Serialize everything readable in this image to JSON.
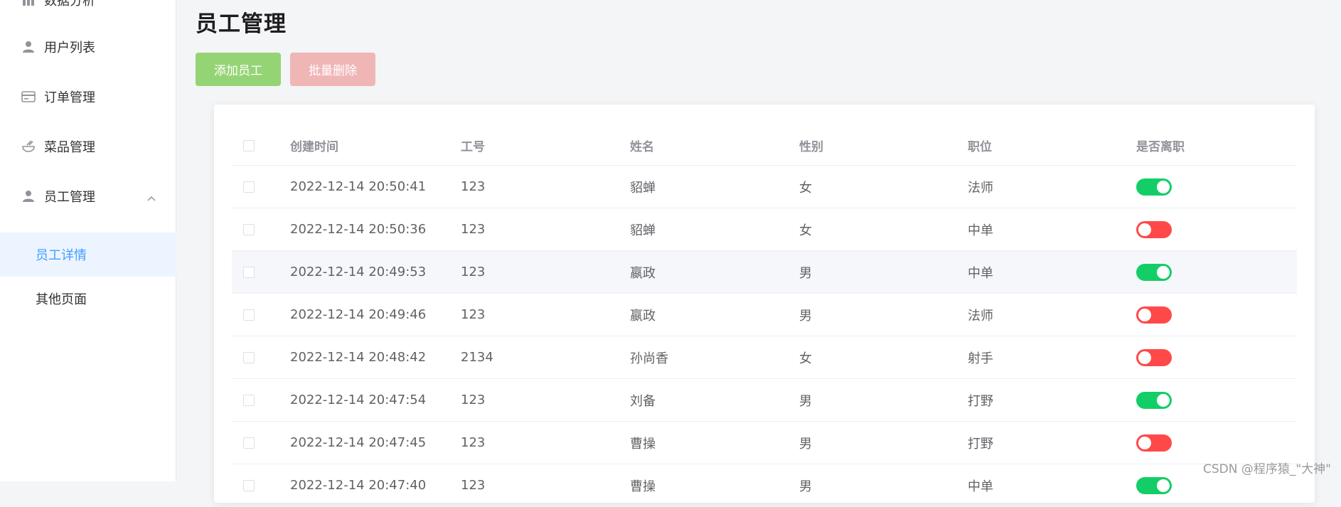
{
  "sidebar": {
    "items": [
      {
        "label": "数据分析",
        "icon": "chart-icon"
      },
      {
        "label": "用户列表",
        "icon": "user-icon"
      },
      {
        "label": "订单管理",
        "icon": "card-icon"
      },
      {
        "label": "菜品管理",
        "icon": "dish-icon"
      },
      {
        "label": "员工管理",
        "icon": "user-icon",
        "expanded": true
      }
    ],
    "subitems": [
      {
        "label": "员工详情",
        "active": true
      },
      {
        "label": "其他页面",
        "active": false
      }
    ]
  },
  "page": {
    "title": "员工管理",
    "add_button": "添加员工",
    "delete_button": "批量删除"
  },
  "table": {
    "columns": [
      "创建时间",
      "工号",
      "姓名",
      "性别",
      "职位",
      "是否离职"
    ],
    "rows": [
      {
        "time": "2022-12-14 20:50:41",
        "id": "123",
        "name": "貂蝉",
        "sex": "女",
        "position": "法师",
        "resigned": true
      },
      {
        "time": "2022-12-14 20:50:36",
        "id": "123",
        "name": "貂蝉",
        "sex": "女",
        "position": "中单",
        "resigned": false
      },
      {
        "time": "2022-12-14 20:49:53",
        "id": "123",
        "name": "嬴政",
        "sex": "男",
        "position": "中单",
        "resigned": true
      },
      {
        "time": "2022-12-14 20:49:46",
        "id": "123",
        "name": "嬴政",
        "sex": "男",
        "position": "法师",
        "resigned": false
      },
      {
        "time": "2022-12-14 20:48:42",
        "id": "2134",
        "name": "孙尚香",
        "sex": "女",
        "position": "射手",
        "resigned": false
      },
      {
        "time": "2022-12-14 20:47:54",
        "id": "123",
        "name": "刘备",
        "sex": "男",
        "position": "打野",
        "resigned": true
      },
      {
        "time": "2022-12-14 20:47:45",
        "id": "123",
        "name": "曹操",
        "sex": "男",
        "position": "打野",
        "resigned": false
      },
      {
        "time": "2022-12-14 20:47:40",
        "id": "123",
        "name": "曹操",
        "sex": "男",
        "position": "中单",
        "resigned": true
      }
    ]
  },
  "watermark": "CSDN @程序猿_\"大神\"",
  "colors": {
    "switch_on": "#13ce66",
    "switch_off": "#ff4949",
    "add_button": "#95d475",
    "delete_button": "#f0b6b6",
    "active_menu": "#409eff"
  }
}
